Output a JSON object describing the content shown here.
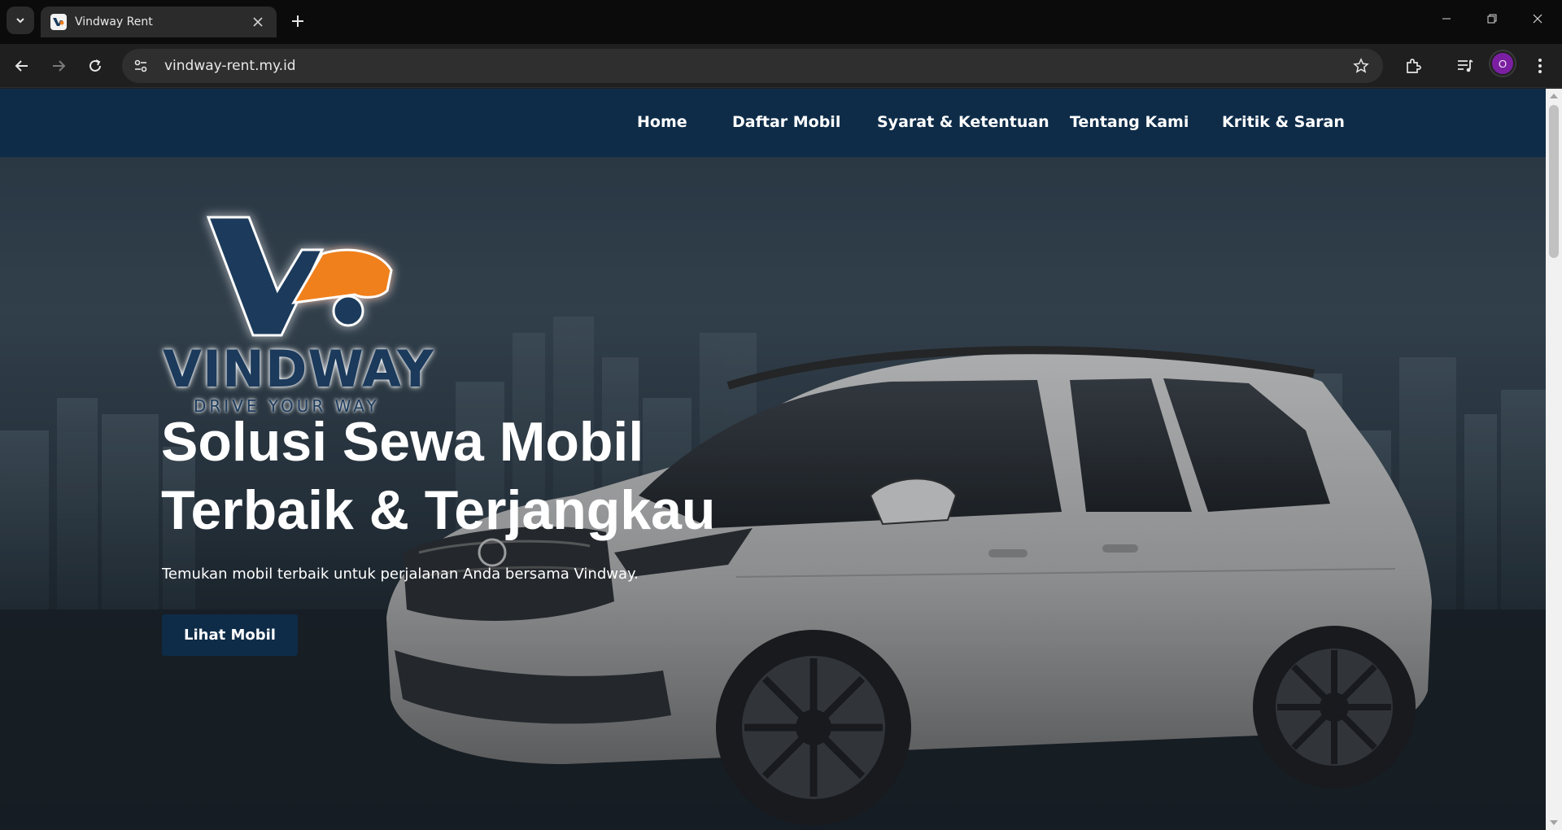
{
  "browser": {
    "tab_title": "Vindway Rent",
    "url": "vindway-rent.my.id",
    "profile_initial": "O"
  },
  "nav": {
    "items": [
      {
        "label": "Home"
      },
      {
        "label": "Daftar Mobil"
      },
      {
        "label": "Syarat & Ketentuan"
      },
      {
        "label": "Tentang Kami"
      },
      {
        "label": "Kritik & Saran"
      }
    ]
  },
  "logo": {
    "name": "VINDWAY",
    "tagline": "DRIVE YOUR WAY"
  },
  "hero": {
    "title_line1": "Solusi Sewa Mobil",
    "title_line2": "Terbaik & Terjangkau",
    "subtitle": "Temukan mobil terbaik untuk perjalanan Anda bersama Vindway.",
    "button_label": "Lihat Mobil"
  },
  "colors": {
    "nav_background": "#0e2c48",
    "brand_navy": "#1b3a5c",
    "brand_orange": "#f0801e",
    "avatar": "#7b1fa2"
  }
}
